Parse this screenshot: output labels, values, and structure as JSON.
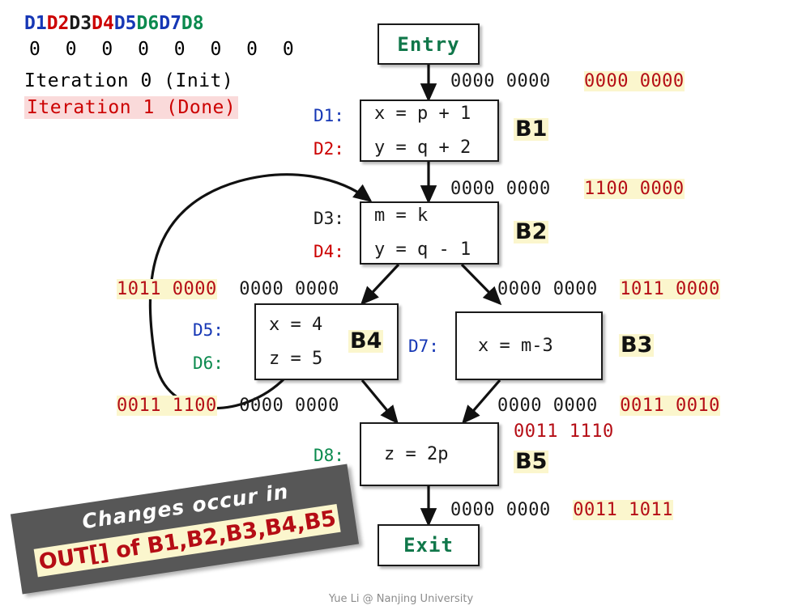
{
  "legend": {
    "definitions": [
      {
        "label": "D1",
        "color": "#1637b5"
      },
      {
        "label": "D2",
        "color": "#cc0000"
      },
      {
        "label": "D3",
        "color": "#1a1a1a"
      },
      {
        "label": "D4",
        "color": "#cc0000"
      },
      {
        "label": "D5",
        "color": "#1637b5"
      },
      {
        "label": "D6",
        "color": "#0b8a4e"
      },
      {
        "label": "D7",
        "color": "#1637b5"
      },
      {
        "label": "D8",
        "color": "#0b8a4e"
      }
    ],
    "bits": "0 0 0 0 0 0 0 0",
    "iteration_0": "Iteration 0 (Init)",
    "iteration_1": "Iteration 1 (Done)",
    "iteration_1_color": "#cc0000",
    "iteration_1_highlight": "#fadada"
  },
  "graph": {
    "entry": {
      "label": "Entry",
      "color": "#10774a"
    },
    "exit": {
      "label": "Exit",
      "color": "#10774a"
    },
    "blocks": [
      {
        "tag": "B1",
        "defs": [
          {
            "id": "D1:",
            "color": "#1637b5",
            "stmt": "x = p + 1"
          },
          {
            "id": "D2:",
            "color": "#cc0000",
            "stmt": "y = q + 2"
          }
        ]
      },
      {
        "tag": "B2",
        "defs": [
          {
            "id": "D3:",
            "color": "#1a1a1a",
            "stmt": "m = k"
          },
          {
            "id": "D4:",
            "color": "#cc0000",
            "stmt": "y = q - 1"
          }
        ]
      },
      {
        "tag": "B4",
        "defs": [
          {
            "id": "D5:",
            "color": "#1637b5",
            "stmt": "x = 4"
          },
          {
            "id": "D6:",
            "color": "#0b8a4e",
            "stmt": "z = 5"
          }
        ]
      },
      {
        "tag": "B3",
        "defs": [
          {
            "id": "D7:",
            "color": "#1637b5",
            "stmt": "x = m-3"
          }
        ]
      },
      {
        "tag": "B5",
        "defs": [
          {
            "id": "D8:",
            "color": "#0b8a4e",
            "stmt": "z = 2p"
          }
        ]
      }
    ]
  },
  "bitvectors": {
    "entry_out": {
      "black": "0000 0000",
      "red": "0000 0000",
      "red_highlight": true
    },
    "b1_out": {
      "black": "0000 0000",
      "red": "1100 0000",
      "red_highlight": true
    },
    "b2_out_left": {
      "red": "1011 0000",
      "black": "0000 0000",
      "red_highlight": true
    },
    "b2_out_right": {
      "black": "0000 0000",
      "red": "1011 0000",
      "red_highlight": true
    },
    "b4_out": {
      "red": "0011 1100",
      "black": "0000 0000",
      "red_highlight": true
    },
    "b3_out": {
      "black": "0000 0000",
      "red": "0011 0010",
      "red_highlight": true
    },
    "b5_in_extra": {
      "red": "0011 1110",
      "red_highlight": false
    },
    "b5_out": {
      "black": "0000 0000",
      "red": "0011 1011",
      "red_highlight": true
    }
  },
  "banner": {
    "line1": "Changes occur in",
    "line2": "OUT[] of B1,B2,B3,B4,B5",
    "background": "#575757",
    "line2_color": "#b50d15",
    "line2_highlight": "#fbf6cd"
  },
  "footer": "Yue Li @ Nanjing University"
}
